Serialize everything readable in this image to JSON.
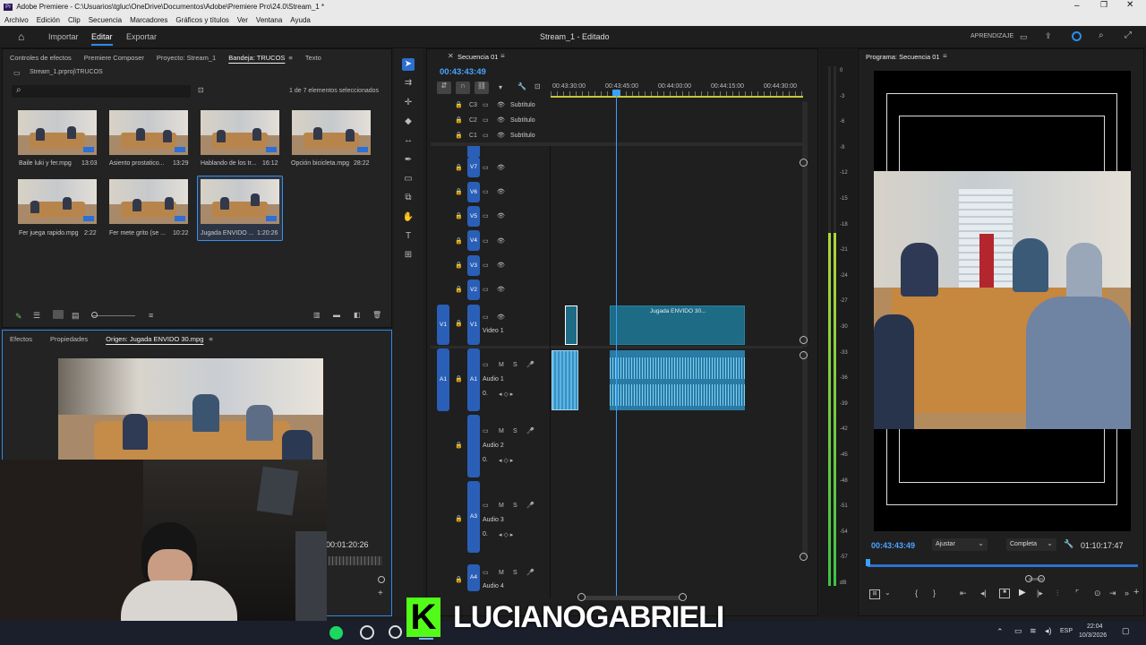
{
  "window": {
    "title": "Adobe Premiere - C:\\Usuarios\\tgluc\\OneDrive\\Documentos\\Adobe\\Premiere Pro\\24.0\\Stream_1 *",
    "app_icon": "Pr"
  },
  "menu": [
    "Archivo",
    "Edición",
    "Clip",
    "Secuencia",
    "Marcadores",
    "Gráficos y títulos",
    "Ver",
    "Ventana",
    "Ayuda"
  ],
  "header": {
    "nav": [
      "Importar",
      "Editar",
      "Exportar"
    ],
    "active": "Editar",
    "title": "Stream_1 - Editado",
    "learn": "APRENDIZAJE"
  },
  "project_panel": {
    "tabs": [
      "Controles de efectos",
      "Premiere Composer",
      "Proyecto: Stream_1",
      "Bandeja: TRUCOS",
      "Texto"
    ],
    "active_tab": "Bandeja: TRUCOS",
    "path": "Stream_1.prproj\\TRUCOS",
    "selection_status": "1 de 7 elementos seleccionados",
    "items": [
      {
        "name": "Baile luki y fer.mpg",
        "duration": "13:03"
      },
      {
        "name": "Asiento prostatico...",
        "duration": "13:29"
      },
      {
        "name": "Hablando de los tr...",
        "duration": "16:12"
      },
      {
        "name": "Opción bicicleta.mpg",
        "duration": "28:22"
      },
      {
        "name": "Fer juega rapido.mpg",
        "duration": "2:22"
      },
      {
        "name": "Fer mete grito (se ...",
        "duration": "10:22"
      },
      {
        "name": "Jugada ENVIDO ...",
        "duration": "1:20:26"
      }
    ]
  },
  "source_panel": {
    "tabs": [
      "Efectos",
      "Propiedades",
      "Origen: Jugada ENVIDO 30.mpg"
    ],
    "active_tab": "Origen: Jugada ENVIDO 30.mpg",
    "timecode": "00:01:20:26"
  },
  "timeline": {
    "tab": "Secuencia 01",
    "timecode": "00:43:43:49",
    "ruler": [
      "00:43:30:00",
      "00:43:45:00",
      "00:44:00:00",
      "00:44:15:00",
      "00:44:30:00"
    ],
    "caption_tracks": [
      "C3",
      "C2",
      "C1"
    ],
    "caption_label": "Subtítulo",
    "video_tracks": [
      "V7",
      "V6",
      "V5",
      "V4",
      "V3",
      "V2"
    ],
    "v1": {
      "src": "V1",
      "target": "V1",
      "name": "Video 1"
    },
    "audio_tracks": [
      {
        "src": "A1",
        "target": "A1",
        "name": "Audio 1",
        "vol": "0."
      },
      {
        "target": "A2",
        "name": "Audio 2",
        "vol": "0."
      },
      {
        "target": "A3",
        "name": "Audio 3",
        "vol": "0."
      },
      {
        "target": "A4",
        "name": "Audio 4"
      }
    ],
    "clip_name": "Jugada ENVIDO 30...",
    "mute": "M",
    "solo": "S"
  },
  "meter": {
    "ticks": [
      "0",
      "-3",
      "-6",
      "-9",
      "-12",
      "-15",
      "-18",
      "-21",
      "-24",
      "-27",
      "-30",
      "-33",
      "-36",
      "-39",
      "-42",
      "-45",
      "-48",
      "-51",
      "-54",
      "-57",
      "dB"
    ],
    "level_fraction": 0.68
  },
  "program_panel": {
    "tab": "Programa: Secuencia 01",
    "timecode": "00:43:43:49",
    "fit": "Ajustar",
    "quality": "Completa",
    "duration": "01:10:17:47"
  },
  "overlay": {
    "streamer": "LUCIANOGABRIELI",
    "logo": "K"
  },
  "taskbar": {
    "lang": "ESP",
    "time": "22:04",
    "date": "10/3/2026"
  },
  "colors": {
    "accent": "#2d8ceb",
    "clip": "#1e6b86",
    "audio": "#59b7e8",
    "target": "#2a5fb8",
    "meter": "#3ec246"
  }
}
